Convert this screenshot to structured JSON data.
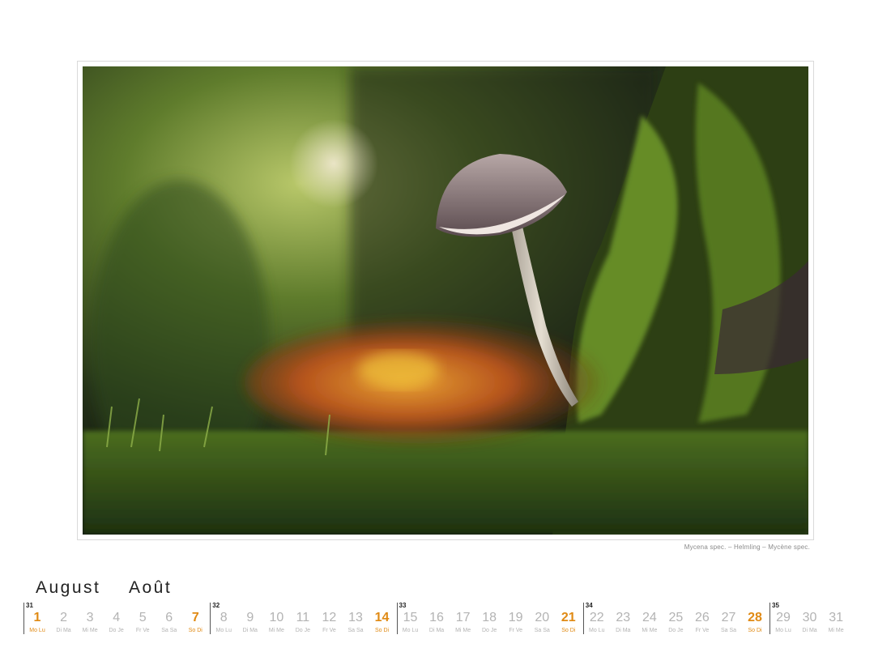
{
  "photo": {
    "subject": "mushroom-on-moss-photo"
  },
  "caption": "Mycena spec. – Helmling – Mycène spec.",
  "month": {
    "de": "August",
    "fr": "Août"
  },
  "colors": {
    "accent": "#e08a14",
    "muted": "#b3b3b3"
  },
  "weeks": [
    {
      "number": "31"
    },
    {
      "number": "32"
    },
    {
      "number": "33"
    },
    {
      "number": "34"
    },
    {
      "number": "35"
    }
  ],
  "days": [
    {
      "num": "1",
      "label": "Mo Lu",
      "sunday": true
    },
    {
      "num": "2",
      "label": "Di Ma"
    },
    {
      "num": "3",
      "label": "Mi Me"
    },
    {
      "num": "4",
      "label": "Do Je"
    },
    {
      "num": "5",
      "label": "Fr Ve"
    },
    {
      "num": "6",
      "label": "Sa Sa"
    },
    {
      "num": "7",
      "label": "So Di",
      "sunday": true
    },
    {
      "num": "8",
      "label": "Mo Lu"
    },
    {
      "num": "9",
      "label": "Di Ma"
    },
    {
      "num": "10",
      "label": "Mi Me"
    },
    {
      "num": "11",
      "label": "Do Je"
    },
    {
      "num": "12",
      "label": "Fr Ve"
    },
    {
      "num": "13",
      "label": "Sa Sa"
    },
    {
      "num": "14",
      "label": "So Di",
      "sunday": true
    },
    {
      "num": "15",
      "label": "Mo Lu"
    },
    {
      "num": "16",
      "label": "Di Ma"
    },
    {
      "num": "17",
      "label": "Mi Me"
    },
    {
      "num": "18",
      "label": "Do Je"
    },
    {
      "num": "19",
      "label": "Fr Ve"
    },
    {
      "num": "20",
      "label": "Sa Sa"
    },
    {
      "num": "21",
      "label": "So Di",
      "sunday": true
    },
    {
      "num": "22",
      "label": "Mo Lu"
    },
    {
      "num": "23",
      "label": "Di Ma"
    },
    {
      "num": "24",
      "label": "Mi Me"
    },
    {
      "num": "25",
      "label": "Do Je"
    },
    {
      "num": "26",
      "label": "Fr Ve"
    },
    {
      "num": "27",
      "label": "Sa Sa"
    },
    {
      "num": "28",
      "label": "So Di",
      "sunday": true
    },
    {
      "num": "29",
      "label": "Mo Lu"
    },
    {
      "num": "30",
      "label": "Di Ma"
    },
    {
      "num": "31",
      "label": "Mi Me"
    }
  ]
}
